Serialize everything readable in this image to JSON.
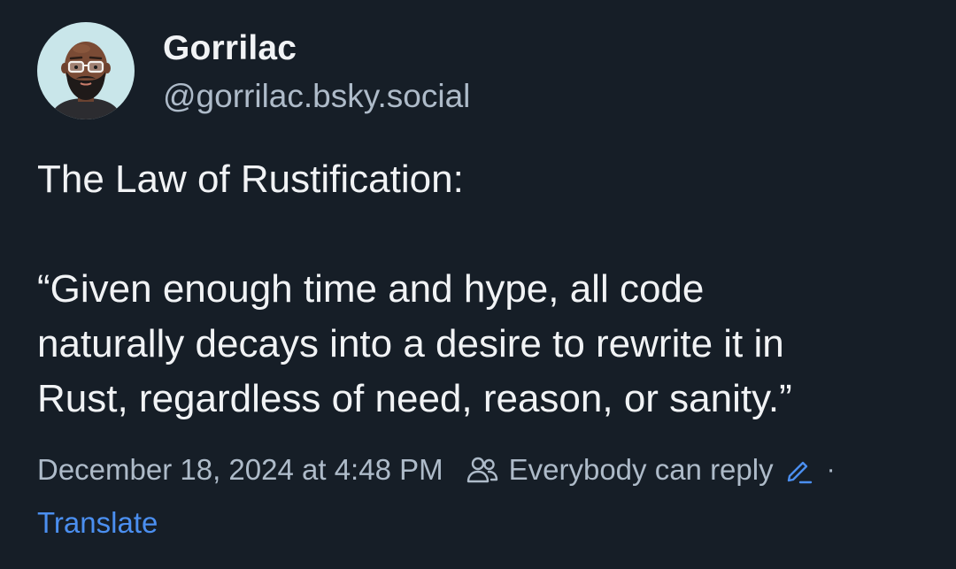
{
  "author": {
    "display_name": "Gorrilac",
    "handle": "@gorrilac.bsky.social",
    "avatar_icon": "avatar-illustration"
  },
  "post": {
    "line1": "The Law of Rustification:",
    "quote": "“Given enough time and hype, all code\nnaturally decays into a desire to rewrite it in\nRust, regardless of need, reason, or sanity.”"
  },
  "meta": {
    "timestamp": "December 18, 2024 at 4:48 PM",
    "reply_icon": "people-icon",
    "reply_setting": "Everybody can reply",
    "edit_icon": "pencil-icon",
    "separator": "·"
  },
  "actions": {
    "translate": "Translate"
  },
  "colors": {
    "background": "#161e27",
    "primary_text": "#f1f3f5",
    "secondary_text": "#aebbc9",
    "link": "#4b8ff0",
    "avatar_bg": "#c9e6ea"
  }
}
